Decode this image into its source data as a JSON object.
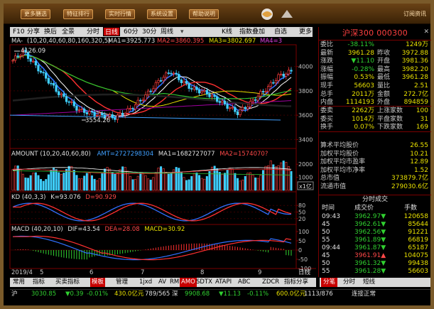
{
  "topbar": {
    "buttons": [
      "更多膳选",
      "特征排行",
      "实时行情",
      "系统设置",
      "帮助说明"
    ],
    "right_text": "订阅资讯"
  },
  "chart_toolbar": {
    "items": [
      "F10",
      "分享",
      "换后",
      "全景",
      "分时",
      "日线",
      "60分",
      "30分",
      "周线",
      "K线",
      "指数叠加",
      "自选",
      "更多"
    ],
    "selected": "日线"
  },
  "ma_legend": {
    "prefix": "MA-",
    "params": "(10,20,40,60,80,160,320,5)",
    "ma1": "MA1=3925.773",
    "ma2": "MA2=3860.395",
    "ma3": "MA3=3802.697",
    "ma4": "MA4=3"
  },
  "price_panel": {
    "high_label": "4126.09",
    "low_label": "3554.26",
    "axis_ticks": [
      "4000",
      "3800",
      "3600",
      "3400"
    ]
  },
  "amount_panel": {
    "legend_name": "AMOUNT",
    "params": "(10,20,40,60,80)",
    "amt": "AMT=2727298304",
    "ma1": "MA1=1682727077",
    "ma2": "MA2=1574070?",
    "axis_ticks": [
      "2000",
      "1000"
    ],
    "unit_badge": "x1亿"
  },
  "kd_panel": {
    "legend_name": "KD",
    "params": "(40,3,3)",
    "k": "K=93.076",
    "d": "D=90.929",
    "axis_ticks": [
      "80",
      "50",
      "20"
    ]
  },
  "macd_panel": {
    "legend_name": "MACD",
    "params": "(40,20,10)",
    "dif": "DIF=43.54",
    "dea": "DEA=28.08",
    "macd": "MACD=30.92",
    "axis_ticks": [
      "100",
      "50",
      "0",
      "-50",
      "-100"
    ]
  },
  "x_axis": {
    "labels": [
      "2019/4",
      "5",
      "6",
      "7",
      "8",
      "9"
    ],
    "right_btn": "日线"
  },
  "bottom_tabs": {
    "items": [
      "常用",
      "指标",
      "买卖指标",
      "模板",
      "管理",
      "1jxd",
      "AV",
      "RM",
      "AMO",
      "SDTX",
      "ATAPI",
      "ABC",
      "ZDCR",
      "指标分享"
    ],
    "selected": "模板"
  },
  "right_panel": {
    "title": "沪深300  000300",
    "rows1": [
      {
        "l": "委比",
        "v": "-38.11%",
        "l2": "",
        "v2": "1249万"
      },
      {
        "l": "最新",
        "v": "3961.28",
        "l2": "昨收",
        "v2": "3972.88"
      },
      {
        "l": "涨跌",
        "v": "▼11.10",
        "l2": "开盘",
        "v2": "3981.36"
      },
      {
        "l": "涨幅",
        "v": "-0.28%",
        "l2": "最高",
        "v2": "3982.20"
      },
      {
        "l": "振幅",
        "v": "0.53%",
        "l2": "最低",
        "v2": "3961.28"
      },
      {
        "l": "现手",
        "v": "56603",
        "l2": "量比",
        "v2": "2.51"
      },
      {
        "l": "总手",
        "v": "2011万",
        "l2": "金额",
        "v2": "272.7亿"
      },
      {
        "l": "内盘",
        "v": "1114193",
        "l2": "外盘",
        "v2": "894859"
      }
    ],
    "rows2": [
      {
        "l": "委卖",
        "v": "2262万",
        "l2": "上涨家数",
        "v2": "100"
      },
      {
        "l": "委买",
        "v": "1014万",
        "l2": "平盘家数",
        "v2": "31"
      },
      {
        "l": "换手",
        "v": "0.07%",
        "l2": "下跌家数",
        "v2": "169"
      }
    ],
    "rows3": [
      {
        "l": "算术平均股价",
        "v": "26.55"
      },
      {
        "l": "加权平均股价",
        "v": "10.21"
      },
      {
        "l": "加权平均市盈率",
        "v": "12.89"
      },
      {
        "l": "加权平均市净率",
        "v": "1.52"
      },
      {
        "l": "总市值",
        "v": "373879.7亿"
      },
      {
        "l": "流通市值",
        "v": "279030.6亿"
      }
    ],
    "ticks_title": "分时成交",
    "ticks_header": [
      "时间",
      "成交价",
      "手数"
    ],
    "ticks": [
      {
        "t": "09:43",
        "p": "3962.97▼",
        "q": "120658"
      },
      {
        "t": "45",
        "p": "3962.61▼",
        "q": "85644"
      },
      {
        "t": "50",
        "p": "3962.56▼",
        "q": "91221"
      },
      {
        "t": "55",
        "p": "3961.89▼",
        "q": "66819"
      },
      {
        "t": "09:44",
        "p": "3961.87▼",
        "q": "65187"
      },
      {
        "t": "45",
        "p": "3961.91▲",
        "q": "104075"
      },
      {
        "t": "50",
        "p": "3961.32▼",
        "q": "99438"
      },
      {
        "t": "55",
        "p": "3961.28▼",
        "q": "56603"
      }
    ],
    "tabs": [
      "分笔",
      "分时",
      "短线"
    ],
    "tab_selected": "分笔"
  },
  "status_bar": [
    {
      "t": "沪",
      "c": "#e0e0e0"
    },
    {
      "t": "3030.85",
      "c": "#30d030"
    },
    {
      "t": "▼0.39",
      "c": "#30d030"
    },
    {
      "t": "-0.01%",
      "c": "#30d030"
    },
    {
      "t": "430.0亿元",
      "c": "#e8e000"
    },
    {
      "t": "789/565",
      "c": "#e0e0e0"
    },
    {
      "t": "深",
      "c": "#e0e0e0"
    },
    {
      "t": "9908.68",
      "c": "#30d030"
    },
    {
      "t": "▼11.13",
      "c": "#30d030"
    },
    {
      "t": "-0.11%",
      "c": "#30d030"
    },
    {
      "t": "600.0亿元",
      "c": "#e8e000"
    },
    {
      "t": "1113/876",
      "c": "#e0e0e0"
    },
    {
      "t": "连接正常",
      "c": "#e0e0e0"
    }
  ]
}
